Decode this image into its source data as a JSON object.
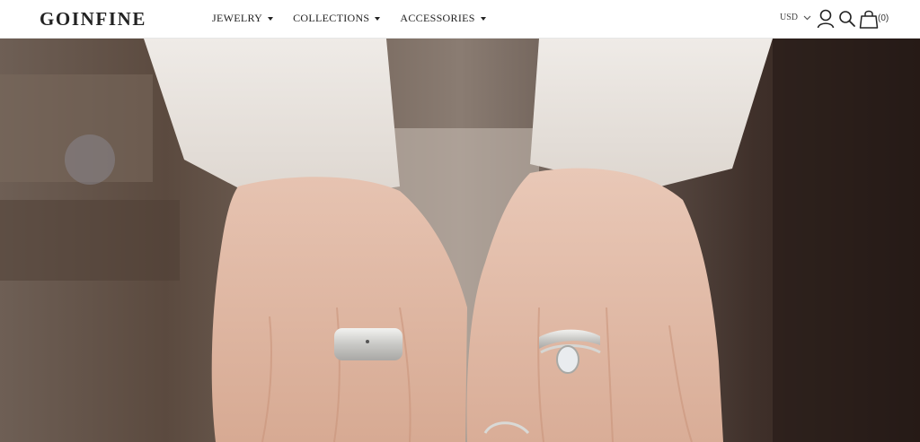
{
  "header": {
    "logo": "GOINFINE",
    "nav": [
      {
        "label": "JEWELRY"
      },
      {
        "label": "COLLECTIONS"
      },
      {
        "label": "ACCESSORIES"
      }
    ],
    "currency": "USD",
    "cart_count": "(0)",
    "icons": [
      "chevron-down-icon",
      "user-icon",
      "search-icon",
      "cart-icon",
      "caret-down-icon"
    ]
  },
  "hero": {
    "subject": "two hands wearing silver rings",
    "colors": {
      "background": "#6b5a4e",
      "skin": "#e0b9a4",
      "sleeve": "#e9e4df",
      "silver": "#d9d9d6"
    }
  }
}
